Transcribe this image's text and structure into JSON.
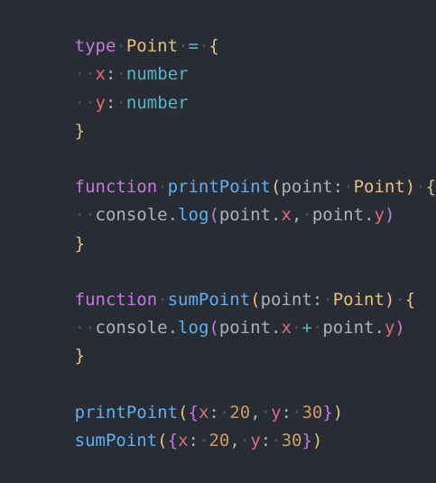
{
  "editor": {
    "theme_colors": {
      "background": "#282c34",
      "keyword": "#c678dd",
      "type": "#e5c07b",
      "function": "#61afef",
      "property": "#e06c75",
      "operator": "#56b6c2",
      "number": "#d19a66",
      "text": "#abb2bf"
    },
    "lines": [
      {
        "text": "type Point = {"
      },
      {
        "text": "  x: number"
      },
      {
        "text": "  y: number"
      },
      {
        "text": "}"
      },
      {
        "text": ""
      },
      {
        "text": "function printPoint(point: Point) {"
      },
      {
        "text": "  console.log(point.x, point.y)"
      },
      {
        "text": "}"
      },
      {
        "text": ""
      },
      {
        "text": "function sumPoint(point: Point) {"
      },
      {
        "text": "  console.log(point.x + point.y)"
      },
      {
        "text": "}"
      },
      {
        "text": ""
      },
      {
        "text": "printPoint({x: 20, y: 30})"
      },
      {
        "text": "sumPoint({x: 20, y: 30})"
      }
    ],
    "tokens": {
      "kw_type": "type",
      "kw_function": "function",
      "type_point": "Point",
      "eq": "=",
      "open_brace": "{",
      "close_brace": "}",
      "prop_x": "x",
      "prop_y": "y",
      "colon": ":",
      "type_number": "number",
      "fn_printPoint": "printPoint",
      "fn_sumPoint": "sumPoint",
      "open_paren": "(",
      "close_paren": ")",
      "param_point": "point",
      "console": "console",
      "dot": ".",
      "fn_log": "log",
      "comma": ",",
      "plus": "+",
      "num_20": "20",
      "num_30": "30"
    }
  }
}
